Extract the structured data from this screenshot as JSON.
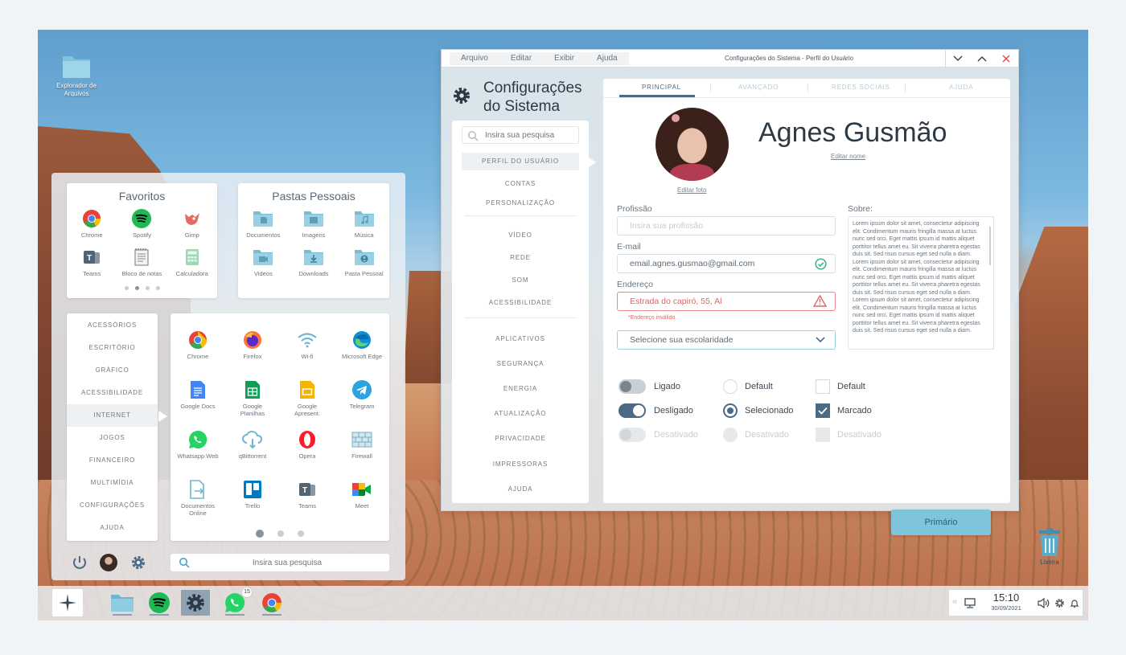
{
  "desktop": {
    "file_explorer_icon_label": "Explorador de Arquivos",
    "trash_label": "Lixeira"
  },
  "launcher": {
    "favorites": {
      "title": "Favoritos",
      "apps": [
        "Chrome",
        "Spotify",
        "Gimp",
        "Teams",
        "Bloco de notas",
        "Calculadora"
      ]
    },
    "folders": {
      "title": "Pastas Pessoais",
      "items": [
        "Documentos",
        "Imagens",
        "Música",
        "Videos",
        "Downloads",
        "Pasta Pessoal"
      ]
    },
    "categories": [
      "ACESSÓRIOS",
      "ESCRITÓRIO",
      "GRÁFICO",
      "ACESSIBILIDADE",
      "INTERNET",
      "JOGOS",
      "FINANCEIRO",
      "MULTIMÍDIA",
      "CONFIGURAÇÕES",
      "AJUDA"
    ],
    "active_category": "INTERNET",
    "apps": [
      "Chrome",
      "Firefox",
      "Wi-fi",
      "Microsoft Edge",
      "Google Docs",
      "Google Planilhas",
      "Google Apresent.",
      "Telegram",
      "Whatsapp Web",
      "qBittorrent",
      "Opera",
      "Firewall",
      "Documentos Online",
      "Trello",
      "Teams",
      "Meet"
    ],
    "search_placeholder": "Insira sua pesquisa"
  },
  "window": {
    "menu": [
      "Arquivo",
      "Editar",
      "Exibir",
      "Ajuda"
    ],
    "title": "Configurações do Sistema - Perfil do Usuário",
    "heading_line1": "Configurações",
    "heading_line2": "do Sistema",
    "search_placeholder": "Insira sua pesquisa",
    "sidebar": {
      "group1": [
        "PERFIL DO USUÁRIO",
        "CONTAS",
        "PERSONALIZAÇÃO"
      ],
      "group2": [
        "VÍDEO",
        "REDE",
        "SOM",
        "ACESSIBILIDADE"
      ],
      "group3": [
        "APLICATIVOS",
        "SEGURANÇA",
        "ENERGIA",
        "ATUALIZAÇÃO",
        "PRIVACIDADE",
        "IMPRESSORAS",
        "AJUDA"
      ]
    },
    "tabs": [
      "PRINCIPAL",
      "AVANÇADO",
      "REDES SOCIAIS",
      "AJUDA"
    ],
    "profile": {
      "name": "Agnes Gusmão",
      "edit_name": "Editar nome",
      "edit_photo": "Editar foto"
    },
    "form": {
      "profession_label": "Profissão",
      "profession_placeholder": "Insira sua profissão",
      "email_label": "E-mail",
      "email_value": "email.agnes.gusmao@gmail.com",
      "address_label": "Endereço",
      "address_value": "Estrada do capiró, 55, Al",
      "address_error": "*Endereço inválido",
      "education_placeholder": "Selecione sua escolaridade",
      "about_label": "Sobre:",
      "about_text": "Lorem ipsum dolor sit amet, consectetur adipiscing elit. Condimentum mauris fringilla massa at luctus nunc sed orci. Eget mattis ipsum id mattis aliquet porttitor tellus amet eu. Sit viverra pharetra egestas duis sit. Sed risus cursus eget sed nulla a diam. Lorem ipsum dolor sit amet, consectetur adipiscing elit. Condimentum mauris fringilla massa at luctus nunc sed orci. Eget mattis ipsum id mattis aliquet porttitor tellus amet eu. Sit viverra pharetra egestas duis sit. Sed risus cursus eget sed nulla a diam. Lorem ipsum dolor sit amet, consectetur adipiscing elit. Condimentum mauris fringilla massa at luctus nunc sed orci. Eget mattis ipsum id mattis aliquet porttitor tellus amet eu. Sit viverra pharetra egestas duis sit. Sed risus cursus eget sed nulla a diam."
    },
    "controls": {
      "toggle_on": "Ligado",
      "toggle_off": "Desligado",
      "toggle_disabled": "Desativado",
      "radio_default": "Default",
      "radio_selected": "Selecionado",
      "radio_disabled": "Desativado",
      "check_default": "Default",
      "check_checked": "Marcado",
      "check_disabled": "Desativado"
    },
    "primary_button": "Primário"
  },
  "taskbar": {
    "whatsapp_badge": "15",
    "time": "15:10",
    "date": "30/09/2021"
  },
  "colors": {
    "accent": "#4b6a85",
    "primary_button": "#7ec5db",
    "error": "#e06565",
    "success": "#3db38a"
  }
}
